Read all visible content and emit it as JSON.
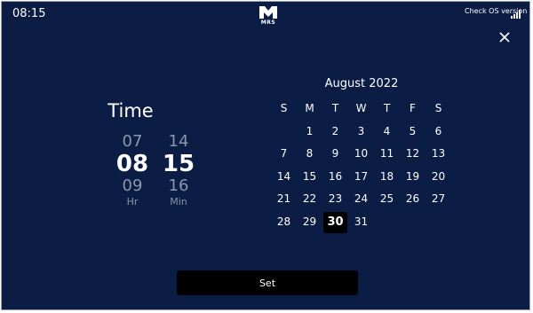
{
  "status_bar": {
    "time": "08:15",
    "logo_text": "MRS",
    "os_version_link": "Check OS version"
  },
  "time_picker": {
    "title": "Time",
    "hours": {
      "prev": "07",
      "selected": "08",
      "next": "09",
      "unit": "Hr"
    },
    "minutes": {
      "prev": "14",
      "selected": "15",
      "next": "16",
      "unit": "Min"
    }
  },
  "calendar": {
    "month_label": "August 2022",
    "weekdays": [
      "S",
      "M",
      "T",
      "W",
      "T",
      "F",
      "S"
    ],
    "weeks": [
      [
        "",
        "1",
        "2",
        "3",
        "4",
        "5",
        "6"
      ],
      [
        "7",
        "8",
        "9",
        "10",
        "11",
        "12",
        "13"
      ],
      [
        "14",
        "15",
        "16",
        "17",
        "18",
        "19",
        "20"
      ],
      [
        "21",
        "22",
        "23",
        "24",
        "25",
        "26",
        "27"
      ],
      [
        "28",
        "29",
        "30",
        "31",
        "",
        "",
        ""
      ]
    ],
    "selected_day": "30"
  },
  "actions": {
    "set_label": "Set"
  },
  "colors": {
    "background": "#0b1d45",
    "button": "#000000",
    "dim_text": "#8c96aa",
    "text": "#ffffff"
  },
  "icons": {
    "close": "close-icon",
    "signal": "signal-icon",
    "logo": "mrs-logo"
  }
}
